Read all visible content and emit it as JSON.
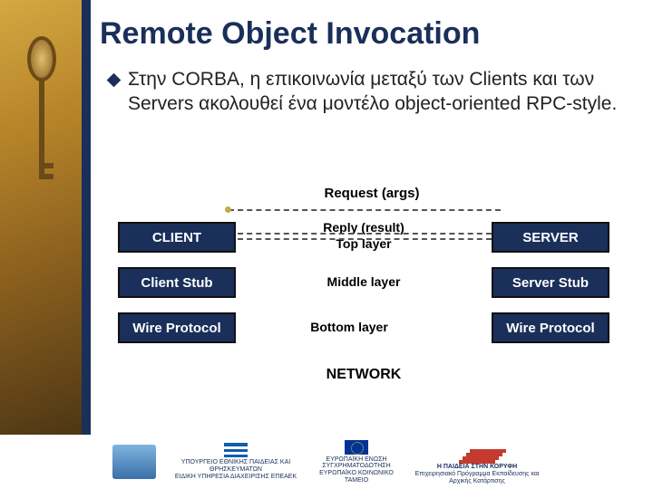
{
  "title": "Remote Object Invocation",
  "bullet": "Στην CORBA, η επικοινωνία μεταξύ των Clients και των Servers ακολουθεί ένα μοντέλο object-oriented RPC-style.",
  "diagram": {
    "request_label": "Request (args)",
    "reply_label": "Reply (result)",
    "top_layer": "Top layer",
    "middle_layer": "Middle layer",
    "bottom_layer": "Bottom layer",
    "network": "NETWORK",
    "left_boxes": [
      "CLIENT",
      "Client Stub",
      "Wire Protocol"
    ],
    "right_boxes": [
      "SERVER",
      "Server Stub",
      "Wire Protocol"
    ]
  },
  "footer": {
    "ministry": "ΥΠΟΥΡΓΕΙΟ ΕΘΝΙΚΗΣ ΠΑΙΔΕΙΑΣ ΚΑΙ ΘΡΗΣΚΕΥΜΑΤΩΝ",
    "eidiki": "ΕΙΔΙΚΗ ΥΠΗΡΕΣΙΑ ΔΙΑΧΕΙΡΙΣΗΣ ΕΠΕΑΕΚ",
    "eu_union": "ΕΥΡΩΠΑΪΚΗ ΕΝΩΣΗ",
    "eu_fund": "ΣΥΓΧΡΗΜΑΤΟΔΟΤΗΣΗ",
    "ekt": "ΕΥΡΩΠΑΪΚΟ ΚΟΙΝΩΝΙΚΟ ΤΑΜΕΙΟ",
    "program_title": "Η ΠΑΙΔΕΙΑ ΣΤΗΝ ΚΟΡΥΦΗ",
    "program_sub": "Επιχειρησιακό Πρόγραμμα Εκπαίδευσης και Αρχικής Κατάρτισης"
  }
}
